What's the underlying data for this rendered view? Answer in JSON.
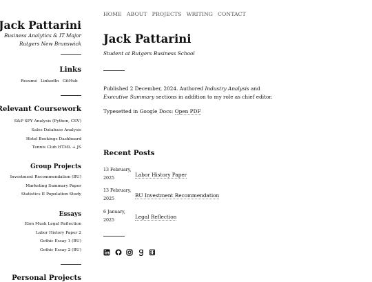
{
  "sidebar": {
    "title": "Jack Pattarini",
    "subtitle_line1": "Business Analytics & IT Major",
    "subtitle_line2": "Rutgers New Brunswick",
    "links": {
      "heading": "Links",
      "items": [
        "Resumé",
        "LinkedIn",
        "GitHub"
      ]
    },
    "coursework": {
      "heading": "Relevant Coursework",
      "items": [
        "S&P SPY Analysis (Python, CSV)",
        "Sales Database Analysis",
        "Hotel Bookings Dashboard",
        "Tennis Club HTML + JS"
      ]
    },
    "group_projects": {
      "heading": "Group Projects",
      "items": [
        "Investment Recommendation (BU)",
        "Marketing Summary Paper",
        "Statistics II Population Study"
      ]
    },
    "essays": {
      "heading": "Essays",
      "items": [
        "Elon Musk Legal Reflection",
        "Labor History Paper 2",
        "Gothic Essay 1 (BU)",
        "Gothic Essay 2 (BU)"
      ]
    },
    "personal_projects": {
      "heading": "Personal Projects"
    }
  },
  "nav": {
    "items": [
      "HOME",
      "ABOUT",
      "PROJECTS",
      "WRITING",
      "CONTACT"
    ]
  },
  "main": {
    "title": "Jack Pattarini",
    "subtitle": "Student at Rutgers Business School",
    "para1": {
      "part1": "Published 2 December, 2024. Authored ",
      "em1": "Industry Analysis",
      "part2": " and ",
      "em2": "Executive Summary",
      "part3": " sections in addition to my role as chief editor."
    },
    "para2": {
      "text": "Typesetted in Google Docs: ",
      "link": "Open PDF"
    },
    "recent_posts": {
      "heading": "Recent Posts",
      "posts": [
        {
          "date_line1": "13 February,",
          "date_line2": "2025",
          "title": "Labor History Paper"
        },
        {
          "date_line1": "13 February,",
          "date_line2": "2025",
          "title": "BU Investment Recommendation"
        },
        {
          "date_line1": "6 January,",
          "date_line2": "2025",
          "title": "Legal Reflection"
        }
      ]
    },
    "social_icons": [
      "linkedin-icon",
      "github-icon",
      "instagram-icon",
      "goodreads-icon",
      "letterboxd-icon"
    ]
  }
}
